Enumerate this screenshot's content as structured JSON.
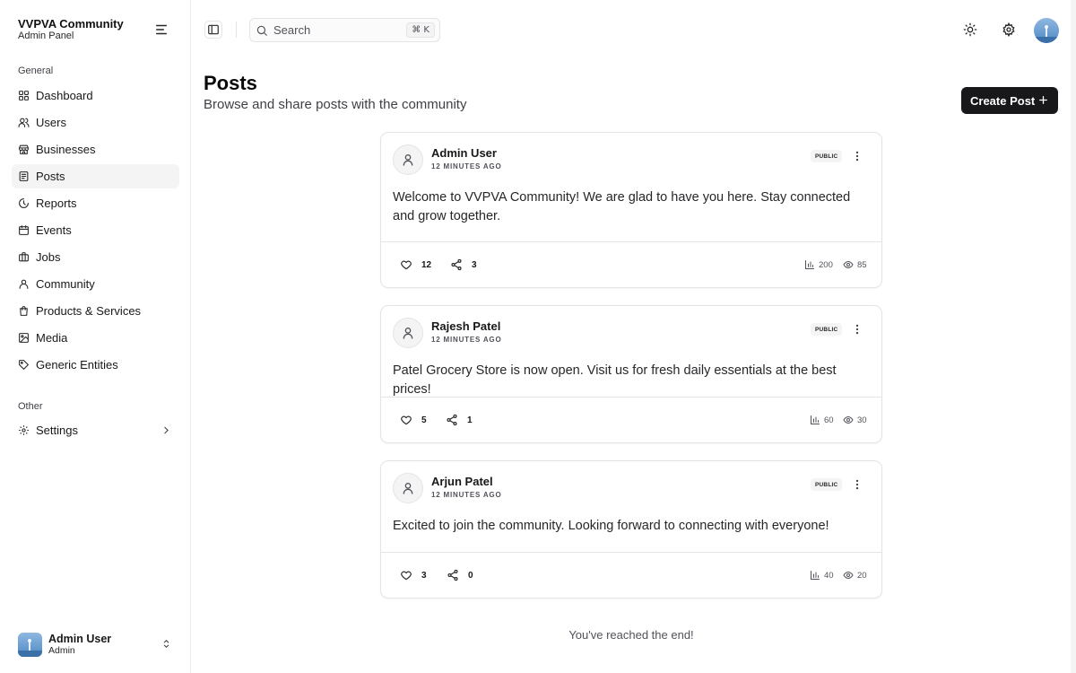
{
  "sidebar": {
    "brand_title": "VVPVA Community",
    "brand_subtitle": "Admin Panel",
    "group_general": "General",
    "group_other": "Other",
    "items": [
      {
        "label": "Dashboard",
        "icon": "dashboard-icon"
      },
      {
        "label": "Users",
        "icon": "users-icon"
      },
      {
        "label": "Businesses",
        "icon": "store-icon"
      },
      {
        "label": "Posts",
        "icon": "posts-icon",
        "active": true
      },
      {
        "label": "Reports",
        "icon": "reports-icon"
      },
      {
        "label": "Events",
        "icon": "calendar-icon"
      },
      {
        "label": "Jobs",
        "icon": "briefcase-icon"
      },
      {
        "label": "Community",
        "icon": "community-icon"
      },
      {
        "label": "Products & Services",
        "icon": "shopping-bag-icon"
      },
      {
        "label": "Media",
        "icon": "image-icon"
      },
      {
        "label": "Generic Entities",
        "icon": "tag-icon"
      }
    ],
    "settings_label": "Settings",
    "user": {
      "name": "Admin User",
      "role": "Admin"
    }
  },
  "header": {
    "search_placeholder": "Search",
    "shortcut": "⌘ K"
  },
  "page": {
    "title": "Posts",
    "subtitle": "Browse and share posts with the community",
    "create_label": "Create Post"
  },
  "posts": [
    {
      "author": "Admin User",
      "time": "12 MINUTES AGO",
      "visibility": "PUBLIC",
      "content": "Welcome to VVPVA Community! We are glad to have you here. Stay connected and grow together.",
      "likes": "12",
      "shares": "3",
      "impressions": "200",
      "views": "85"
    },
    {
      "author": "Rajesh Patel",
      "time": "12 MINUTES AGO",
      "visibility": "PUBLIC",
      "content": "Patel Grocery Store is now open. Visit us for fresh daily essentials at the best prices!",
      "likes": "5",
      "shares": "1",
      "impressions": "60",
      "views": "30"
    },
    {
      "author": "Arjun Patel",
      "time": "12 MINUTES AGO",
      "visibility": "PUBLIC",
      "content": "Excited to join the community. Looking forward to connecting with everyone!",
      "likes": "3",
      "shares": "0",
      "impressions": "40",
      "views": "20"
    }
  ],
  "end_message": "You've reached the end!",
  "colors": {
    "primary": "#18181b",
    "active_bg": "#f4f4f5",
    "border": "#e4e4e7"
  }
}
